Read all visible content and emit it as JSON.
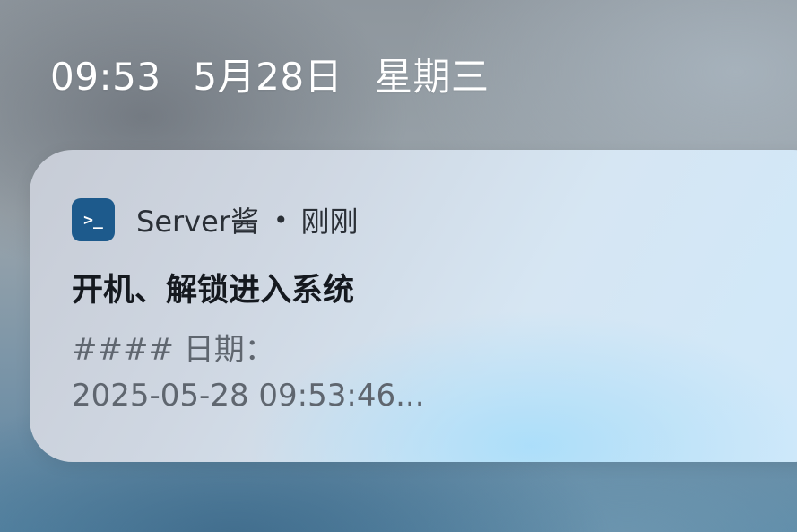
{
  "status": {
    "time": "09:53",
    "date": "5月28日",
    "weekday": "星期三"
  },
  "notification": {
    "app_icon": "terminal-icon",
    "app_icon_glyph": ">_",
    "app_name": "Server酱",
    "separator": "•",
    "time_ago": "刚刚",
    "title": "开机、解锁进入系统",
    "body_line1": "#### 日期：",
    "body_line2": "2025-05-28 09:53:46...",
    "colors": {
      "icon_bg": "#1d5a8c",
      "title": "#15191f",
      "body": "#5f666f"
    }
  }
}
